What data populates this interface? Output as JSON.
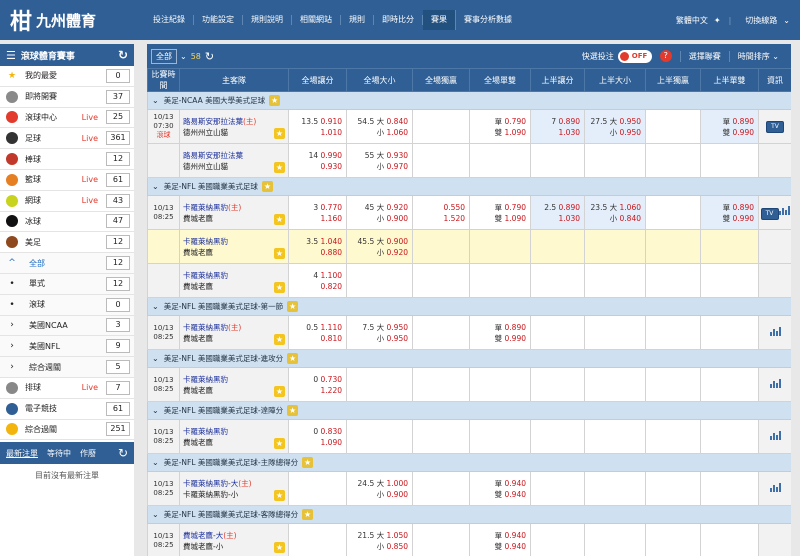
{
  "brand": {
    "name": "九州體育",
    "mark": "柑"
  },
  "topnav": [
    "投注紀錄",
    "功能設定",
    "規則說明",
    "相關網站",
    "規則",
    "即時比分",
    "賽果",
    "賽事分析數據"
  ],
  "topnav_active": 6,
  "topright": {
    "user": "繁體中文",
    "lines": "切換線路"
  },
  "sidebar": {
    "title": "滾球體育賽事",
    "items": [
      {
        "label": "我的最愛",
        "live": "",
        "count": "0",
        "icon": "star-icon",
        "color": "#f3b40e"
      },
      {
        "label": "即將開賽",
        "live": "",
        "count": "37",
        "icon": "stopwatch-icon",
        "color": "#8a8a8a"
      },
      {
        "label": "滾球中心",
        "live": "Live",
        "count": "25",
        "icon": "play-icon",
        "color": "#e23a2c"
      },
      {
        "label": "足球",
        "live": "Live",
        "count": "361",
        "icon": "soccer-ball-icon",
        "color": "#333333"
      },
      {
        "label": "棒球",
        "live": "",
        "count": "12",
        "icon": "baseball-icon",
        "color": "#c0392b"
      },
      {
        "label": "籃球",
        "live": "Live",
        "count": "61",
        "icon": "basketball-icon",
        "color": "#e67e22"
      },
      {
        "label": "網球",
        "live": "Live",
        "count": "43",
        "icon": "tennis-ball-icon",
        "color": "#c7d31d"
      },
      {
        "label": "冰球",
        "live": "",
        "count": "47",
        "icon": "hockey-puck-icon",
        "color": "#111111"
      },
      {
        "label": "美足",
        "live": "",
        "count": "12",
        "icon": "american-football-icon",
        "color": "#8e4a1e"
      }
    ],
    "sub_items": [
      {
        "label": "全部",
        "count": "12",
        "active": true
      },
      {
        "label": "單式",
        "count": "12"
      },
      {
        "label": "滾球",
        "count": "0"
      }
    ],
    "leagues": [
      {
        "label": "美國NCAA",
        "count": "3"
      },
      {
        "label": "美國NFL",
        "count": "9"
      },
      {
        "label": "綜合週關",
        "count": "5"
      }
    ],
    "more_items": [
      {
        "label": "排球",
        "live": "Live",
        "count": "7",
        "icon": "volleyball-icon",
        "color": "#888888"
      },
      {
        "label": "電子競技",
        "live": "",
        "count": "61",
        "icon": "gamepad-icon",
        "color": "#2f5f94"
      },
      {
        "label": "綜合過關",
        "live": "",
        "count": "251",
        "icon": "parlay-icon",
        "color": "#f3b40e"
      }
    ],
    "bet_tabs": [
      "最新注單",
      "等待中",
      "作廢"
    ],
    "no_bets": "目前沒有最新注單"
  },
  "toolbar": {
    "filter": "全部",
    "count": "58",
    "quick_label": "快選投注",
    "toggle": "OFF",
    "select_league": "選擇聯賽",
    "sort": "時間排序"
  },
  "columns": [
    "比賽時間",
    "主客隊",
    "全場讓分",
    "全場大小",
    "全場獨贏",
    "全場單雙",
    "上半讓分",
    "上半大小",
    "上半獨贏",
    "上半單雙",
    "資訊"
  ],
  "leagues": [
    {
      "name": "美足-NCAA 美國大學美式足球",
      "matches": [
        {
          "date": "10/13",
          "time": "07:30",
          "inplay": "滾球",
          "home": "路易斯安那拉法葉",
          "home_mark": "(主)",
          "away": "德州州立山貓",
          "hdp": [
            "13.5",
            "0.910",
            "",
            "1.010"
          ],
          "ou": [
            "54.5 大",
            "0.840",
            "小",
            "1.060"
          ],
          "ml": [
            "",
            ""
          ],
          "oe": [
            "單",
            "0.790",
            "雙",
            "1.090"
          ],
          "h_hdp": [
            "7",
            "0.890",
            "",
            "1.030"
          ],
          "h_ou": [
            "27.5 大",
            "0.950",
            "小",
            "0.950"
          ],
          "h_ml": [
            "",
            ""
          ],
          "h_oe": [
            "單",
            "0.890",
            "雙",
            "0.990"
          ],
          "tv": true,
          "stats": false
        },
        {
          "date": "",
          "time": "",
          "inplay": "",
          "home": "路易斯安那拉法葉",
          "home_mark": "",
          "away": "德州州立山貓",
          "hdp": [
            "14",
            "0.990",
            "",
            "0.930"
          ],
          "ou": [
            "55 大",
            "0.930",
            "小",
            "0.970"
          ],
          "ml": [
            "",
            ""
          ],
          "oe": [
            "",
            "",
            "",
            ""
          ],
          "h_hdp": [
            "",
            "",
            "",
            ""
          ],
          "h_ou": [
            "",
            "",
            "",
            ""
          ],
          "h_ml": [
            "",
            ""
          ],
          "h_oe": [
            "",
            "",
            "",
            ""
          ],
          "tv": false,
          "stats": false
        }
      ]
    },
    {
      "name": "美足-NFL 美國職業美式足球",
      "matches": [
        {
          "date": "10/13",
          "time": "08:25",
          "inplay": "",
          "home": "卡羅萊納黑豹",
          "home_mark": "(主)",
          "away": "費城老鷹",
          "hdp": [
            "3",
            "0.770",
            "",
            "1.160"
          ],
          "ou": [
            "45 大",
            "0.920",
            "小",
            "0.900"
          ],
          "ml": [
            "0.550",
            "1.520"
          ],
          "oe": [
            "單",
            "0.790",
            "雙",
            "1.090"
          ],
          "h_hdp": [
            "2.5",
            "0.890",
            "",
            "1.030"
          ],
          "h_ou": [
            "23.5 大",
            "1.060",
            "小",
            "0.840"
          ],
          "h_ml": [
            "",
            ""
          ],
          "h_oe": [
            "單",
            "0.890",
            "雙",
            "0.990"
          ],
          "tv": true,
          "stats": true
        },
        {
          "date": "",
          "time": "",
          "inplay": "",
          "home": "卡羅萊納黑豹",
          "home_mark": "",
          "away": "費城老鷹",
          "hdp": [
            "3.5",
            "1.040",
            "",
            "0.880"
          ],
          "ou": [
            "45.5 大",
            "0.900",
            "小",
            "0.920"
          ],
          "ml": [
            "",
            ""
          ],
          "oe": [
            "",
            "",
            "",
            ""
          ],
          "h_hdp": [
            "",
            "",
            "",
            ""
          ],
          "h_ou": [
            "",
            "",
            "",
            ""
          ],
          "h_ml": [
            "",
            ""
          ],
          "h_oe": [
            "",
            "",
            "",
            ""
          ],
          "tv": false,
          "stats": false,
          "highlight": true
        },
        {
          "date": "",
          "time": "",
          "inplay": "",
          "home": "卡羅萊納黑豹",
          "home_mark": "",
          "away": "費城老鷹",
          "hdp": [
            "4",
            "1.100",
            "",
            "0.820"
          ],
          "ou": [
            "",
            "",
            "",
            ""
          ],
          "ml": [
            "",
            ""
          ],
          "oe": [
            "",
            "",
            "",
            ""
          ],
          "h_hdp": [
            "",
            "",
            "",
            ""
          ],
          "h_ou": [
            "",
            "",
            "",
            ""
          ],
          "h_ml": [
            "",
            ""
          ],
          "h_oe": [
            "",
            "",
            "",
            ""
          ],
          "tv": false,
          "stats": false
        }
      ]
    },
    {
      "name": "美足-NFL 美國職業美式足球-第一節",
      "matches": [
        {
          "date": "10/13",
          "time": "08:25",
          "inplay": "",
          "home": "卡羅萊納黑豹",
          "home_mark": "(主)",
          "away": "費城老鷹",
          "hdp": [
            "0.5",
            "1.110",
            "",
            "0.810"
          ],
          "ou": [
            "7.5 大",
            "0.950",
            "小",
            "0.950"
          ],
          "ml": [
            "",
            ""
          ],
          "oe": [
            "單",
            "0.890",
            "雙",
            "0.990"
          ],
          "h_hdp": [
            "",
            "",
            "",
            ""
          ],
          "h_ou": [
            "",
            "",
            "",
            ""
          ],
          "h_ml": [
            "",
            ""
          ],
          "h_oe": [
            "",
            "",
            "",
            ""
          ],
          "tv": false,
          "stats": true
        }
      ]
    },
    {
      "name": "美足-NFL 美國職業美式足球-進攻分",
      "matches": [
        {
          "date": "10/13",
          "time": "08:25",
          "inplay": "",
          "home": "卡羅萊納黑豹",
          "home_mark": "",
          "away": "費城老鷹",
          "hdp": [
            "0",
            "0.730",
            "",
            "1.220"
          ],
          "ou": [
            "",
            "",
            "",
            ""
          ],
          "ml": [
            "",
            ""
          ],
          "oe": [
            "",
            "",
            "",
            ""
          ],
          "h_hdp": [
            "",
            "",
            "",
            ""
          ],
          "h_ou": [
            "",
            "",
            "",
            ""
          ],
          "h_ml": [
            "",
            ""
          ],
          "h_oe": [
            "",
            "",
            "",
            ""
          ],
          "tv": false,
          "stats": true
        }
      ]
    },
    {
      "name": "美足-NFL 美國職業美式足球-達陣分",
      "matches": [
        {
          "date": "10/13",
          "time": "08:25",
          "inplay": "",
          "home": "卡羅萊納黑豹",
          "home_mark": "",
          "away": "費城老鷹",
          "hdp": [
            "0",
            "0.830",
            "",
            "1.090"
          ],
          "ou": [
            "",
            "",
            "",
            ""
          ],
          "ml": [
            "",
            ""
          ],
          "oe": [
            "",
            "",
            "",
            ""
          ],
          "h_hdp": [
            "",
            "",
            "",
            ""
          ],
          "h_ou": [
            "",
            "",
            "",
            ""
          ],
          "h_ml": [
            "",
            ""
          ],
          "h_oe": [
            "",
            "",
            "",
            ""
          ],
          "tv": false,
          "stats": true
        }
      ]
    },
    {
      "name": "美足-NFL 美國職業美式足球-主隊總得分",
      "matches": [
        {
          "date": "10/13",
          "time": "08:25",
          "inplay": "",
          "home": "卡羅萊納黑豹-大",
          "home_mark": "(主)",
          "away": "卡羅萊納黑豹-小",
          "hdp": [
            "",
            "",
            "",
            ""
          ],
          "ou": [
            "24.5 大",
            "1.000",
            "小",
            "0.900"
          ],
          "ml": [
            "",
            ""
          ],
          "oe": [
            "單",
            "0.940",
            "雙",
            "0.940"
          ],
          "h_hdp": [
            "",
            "",
            "",
            ""
          ],
          "h_ou": [
            "",
            "",
            "",
            ""
          ],
          "h_ml": [
            "",
            ""
          ],
          "h_oe": [
            "",
            "",
            "",
            ""
          ],
          "tv": false,
          "stats": true
        }
      ]
    },
    {
      "name": "美足-NFL 美國職業美式足球-客隊總得分",
      "matches": [
        {
          "date": "10/13",
          "time": "08:25",
          "inplay": "",
          "home": "費城老鷹-大",
          "home_mark": "(主)",
          "away": "費城老鷹-小",
          "hdp": [
            "",
            "",
            "",
            ""
          ],
          "ou": [
            "21.5 大",
            "1.050",
            "小",
            "0.850"
          ],
          "ml": [
            "",
            ""
          ],
          "oe": [
            "單",
            "0.940",
            "雙",
            "0.940"
          ],
          "h_hdp": [
            "",
            "",
            "",
            ""
          ],
          "h_ou": [
            "",
            "",
            "",
            ""
          ],
          "h_ml": [
            "",
            ""
          ],
          "h_oe": [
            "",
            "",
            "",
            ""
          ],
          "tv": false,
          "stats": false
        }
      ]
    }
  ]
}
